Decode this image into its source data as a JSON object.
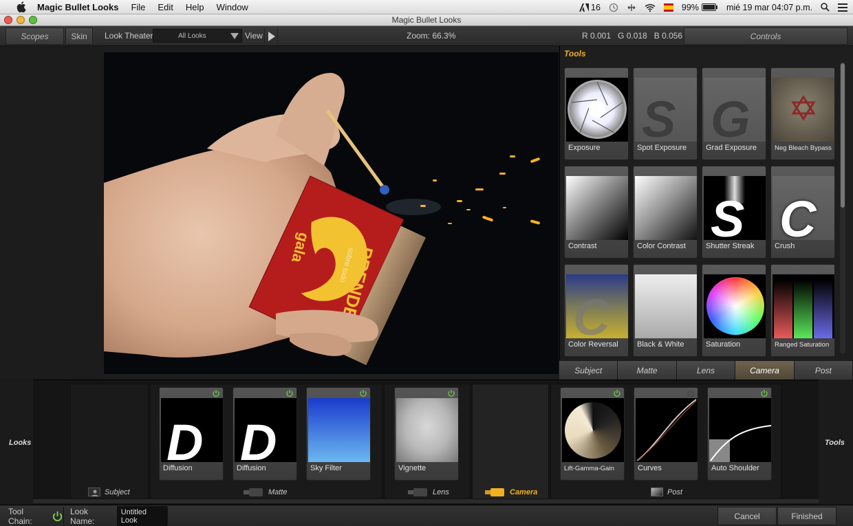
{
  "menubar": {
    "app_name": "Magic Bullet Looks",
    "menus": [
      "File",
      "Edit",
      "Help",
      "Window"
    ],
    "status": {
      "adobe_count": "16",
      "battery": "99%",
      "datetime": "mié 19 mar  04:07 p.m."
    }
  },
  "window": {
    "title": "Magic Bullet Looks"
  },
  "toolbar": {
    "scopes": "Scopes",
    "skin": "Skin",
    "look_theater": "Look Theater",
    "look_select": "All Looks",
    "view": "View",
    "zoom": "Zoom:  66.3%",
    "rgb": "R 0.001   G 0.018   B 0.056",
    "controls": "Controls"
  },
  "tools": {
    "title": "Tools",
    "items": [
      {
        "label": "Exposure"
      },
      {
        "label": "Spot Exposure"
      },
      {
        "label": "Grad Exposure"
      },
      {
        "label": "Neg Bleach Bypass"
      },
      {
        "label": "Contrast"
      },
      {
        "label": "Color Contrast"
      },
      {
        "label": "Shutter Streak"
      },
      {
        "label": "Crush"
      },
      {
        "label": "Color Reversal"
      },
      {
        "label": "Black & White"
      },
      {
        "label": "Saturation"
      },
      {
        "label": "Ranged Saturation"
      }
    ],
    "letters": {
      "s": "S",
      "g": "G",
      "c": "C",
      "d": "D"
    }
  },
  "categories": [
    "Subject",
    "Matte",
    "Lens",
    "Camera",
    "Post"
  ],
  "active_category": "Camera",
  "chain": {
    "looks_label": "Looks",
    "tools_label": "Tools",
    "items": [
      {
        "label": "Diffusion"
      },
      {
        "label": "Diffusion"
      },
      {
        "label": "Sky Filter"
      },
      {
        "label": "Vignette"
      },
      {
        "label": "Lift-Gamma-Gain"
      },
      {
        "label": "Curves"
      },
      {
        "label": "Auto Shoulder"
      }
    ],
    "groups": [
      "Subject",
      "Matte",
      "Lens",
      "Camera",
      "Post"
    ]
  },
  "statusbar": {
    "tool_chain": "Tool Chain:",
    "look_name_label": "Look Name:",
    "look_name_value": "Untitled Look",
    "cancel": "Cancel",
    "finished": "Finished"
  },
  "matchbox": {
    "brand": "PRENDEN",
    "sub": "sobre todo",
    "side": "gala"
  },
  "colors": {
    "accent": "#f0b020",
    "active_tab": "#6f6450"
  }
}
